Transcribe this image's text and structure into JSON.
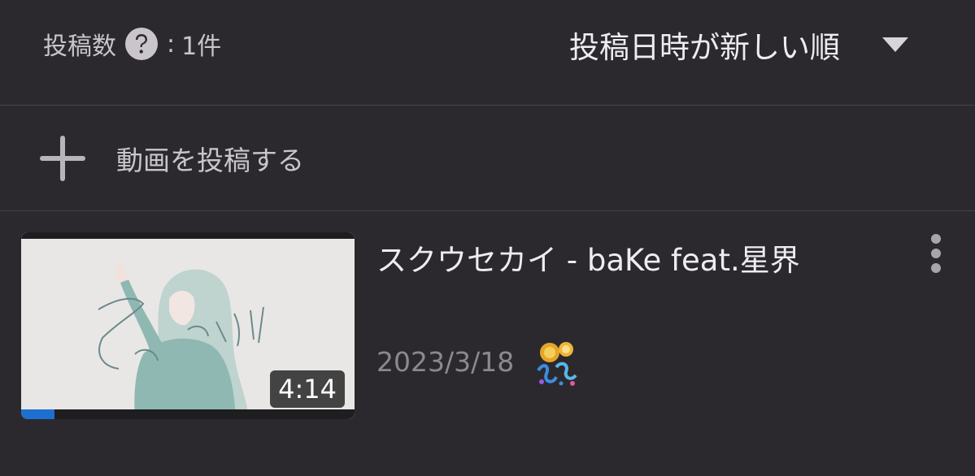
{
  "header": {
    "count_label": "投稿数",
    "help_icon": "question-circle-icon",
    "count_separator": ":",
    "count_value": "1件",
    "sort_label": "投稿日時が新しい順",
    "sort_icon": "caret-down-icon"
  },
  "add_video": {
    "icon": "plus-icon",
    "label": "動画を投稿する"
  },
  "videos": [
    {
      "title": "スクウセカイ - baKe feat.星界",
      "duration": "4:14",
      "date": "2023/3/18",
      "progress_fraction": 0.1,
      "badge_icon": "celebration-badge-icon",
      "menu_icon": "more-vertical-icon"
    }
  ],
  "colors": {
    "background": "#2b292e",
    "divider": "#4a4248",
    "text_primary": "#efebf0",
    "text_secondary": "#c9c5cb",
    "text_muted": "#8c8890",
    "progress": "#1f6fd0"
  }
}
